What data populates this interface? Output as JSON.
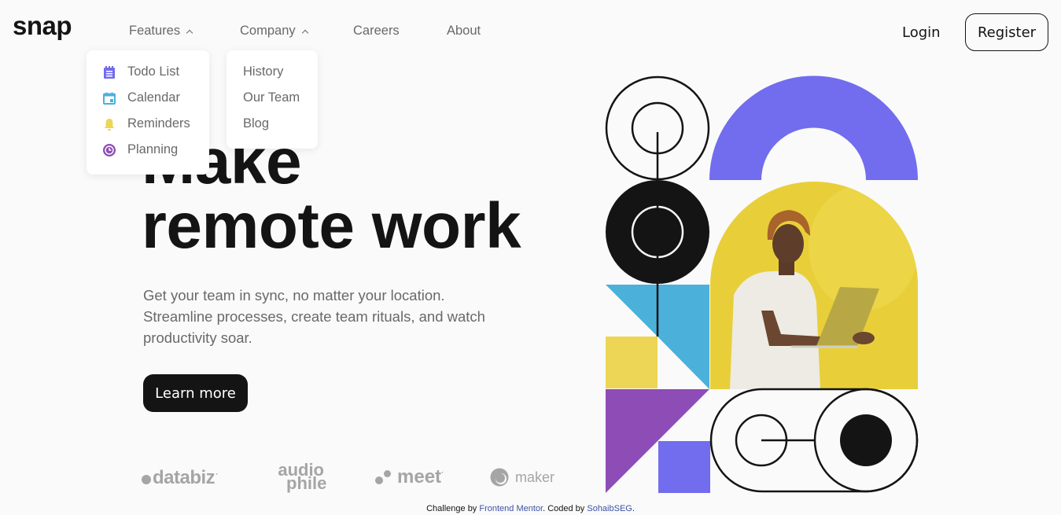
{
  "brand": {
    "logo": "snap"
  },
  "nav": {
    "items": [
      {
        "label": "Features",
        "has_dropdown": true,
        "expanded": true
      },
      {
        "label": "Company",
        "has_dropdown": true,
        "expanded": true
      },
      {
        "label": "Careers",
        "has_dropdown": false
      },
      {
        "label": "About",
        "has_dropdown": false
      }
    ],
    "features_menu": [
      {
        "label": "Todo List",
        "icon": "todo-icon",
        "color": "#726CEE"
      },
      {
        "label": "Calendar",
        "icon": "calendar-icon",
        "color": "#4BB1DA"
      },
      {
        "label": "Reminders",
        "icon": "bell-icon",
        "color": "#EDD556"
      },
      {
        "label": "Planning",
        "icon": "clock-icon",
        "color": "#8E4CB6"
      }
    ],
    "company_menu": [
      {
        "label": "History"
      },
      {
        "label": "Our Team"
      },
      {
        "label": "Blog"
      }
    ],
    "login_label": "Login",
    "register_label": "Register"
  },
  "hero": {
    "title_line1": "Make",
    "title_line2": "remote work",
    "description": "Get your team in sync, no matter your location. Streamline processes, create team rituals, and watch productivity soar.",
    "cta_label": "Learn more"
  },
  "clients": [
    {
      "name": "databiz"
    },
    {
      "name_top": "audio",
      "name_bottom": "phile"
    },
    {
      "name": "meet"
    },
    {
      "name": "maker"
    }
  ],
  "footer": {
    "prefix": "Challenge by ",
    "link1": "Frontend Mentor",
    "middle": ". Coded by ",
    "link2": "SohaibSEG",
    "suffix": "."
  },
  "colors": {
    "background": "#FAFAFA",
    "text_dark": "#141414",
    "text_gray": "#696969",
    "accent_purple": "#726CEE",
    "accent_blue": "#4BB1DA",
    "accent_yellow": "#EDD556",
    "accent_violet": "#8E4CB6",
    "link": "#3E52A3"
  }
}
